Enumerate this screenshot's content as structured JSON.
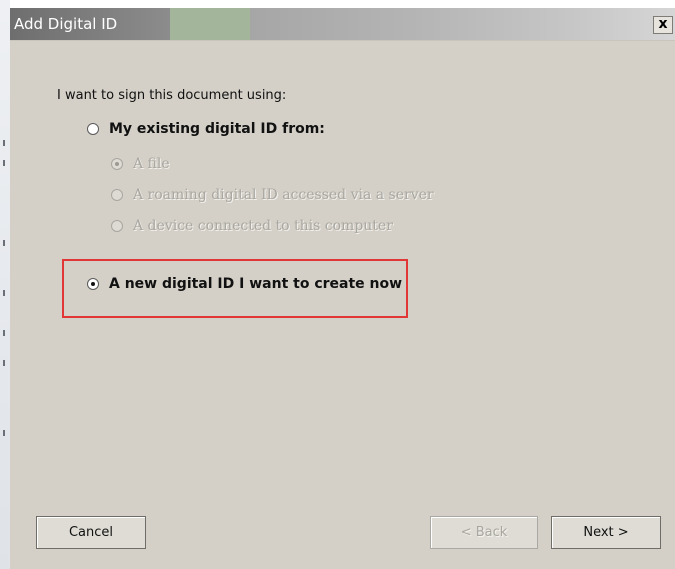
{
  "dialog": {
    "title": "Add Digital ID",
    "close_label": "x"
  },
  "prompt": "I want to sign this document using:",
  "options": {
    "existing": {
      "label": "My existing digital ID from:",
      "selected": false
    },
    "existing_sub": [
      {
        "label": "A file",
        "selected": true,
        "enabled": false
      },
      {
        "label": "A roaming digital ID accessed via a server",
        "selected": false,
        "enabled": false
      },
      {
        "label": "A device connected to this computer",
        "selected": false,
        "enabled": false
      }
    ],
    "new_id": {
      "label": "A new digital ID I want to create now",
      "selected": true
    }
  },
  "highlight_color": "#e23636",
  "buttons": {
    "cancel": "Cancel",
    "back": "< Back",
    "next": "Next >"
  }
}
